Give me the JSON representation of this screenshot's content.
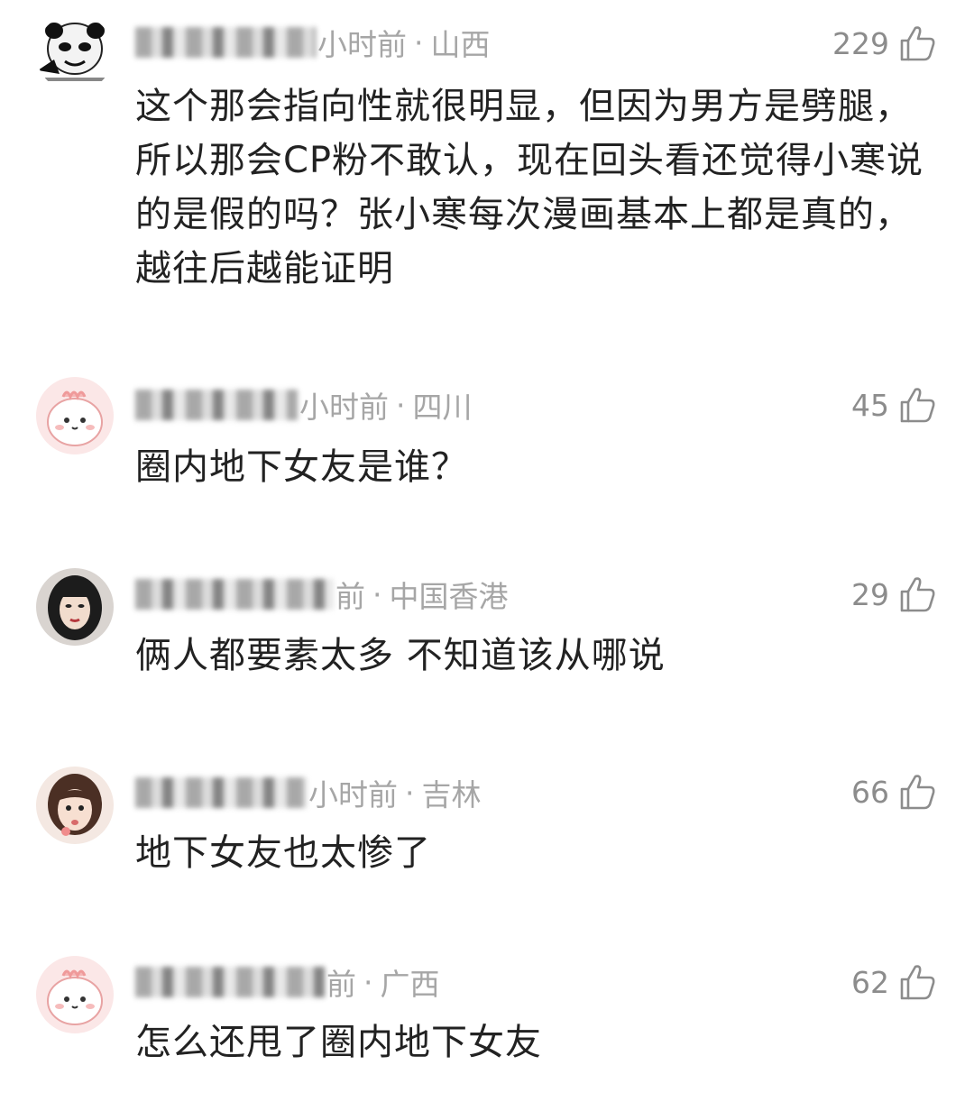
{
  "comments": [
    {
      "avatar": "panda-meme-avatar",
      "time": "小时前",
      "location": "山西",
      "likes": "229",
      "text": "这个那会指向性就很明显，但因为男方是劈腿，所以那会CP粉不敢认，现在回头看还觉得小寒说的是假的吗？张小寒每次漫画基本上都是真的，越往后越能证明"
    },
    {
      "avatar": "pink-cartoon-avatar",
      "time": "小时前",
      "location": "四川",
      "likes": "45",
      "text": "圈内地下女友是谁？"
    },
    {
      "avatar": "woman-portrait-avatar",
      "time": "前",
      "location": "中国香港",
      "likes": "29",
      "text": "俩人都要素太多 不知道该从哪说"
    },
    {
      "avatar": "girl-selfie-avatar",
      "time": "小时前",
      "location": "吉林",
      "likes": "66",
      "text": "地下女友也太惨了"
    },
    {
      "avatar": "pink-cartoon-avatar",
      "time": "前",
      "location": "广西",
      "likes": "62",
      "text": "怎么还甩了圈内地下女友"
    }
  ],
  "colors": {
    "meta": "#a6a6a6",
    "likes": "#8c8c8c",
    "text": "#222222",
    "pink": "#f6dada"
  },
  "icons": {
    "like": "thumbs-up-icon"
  }
}
